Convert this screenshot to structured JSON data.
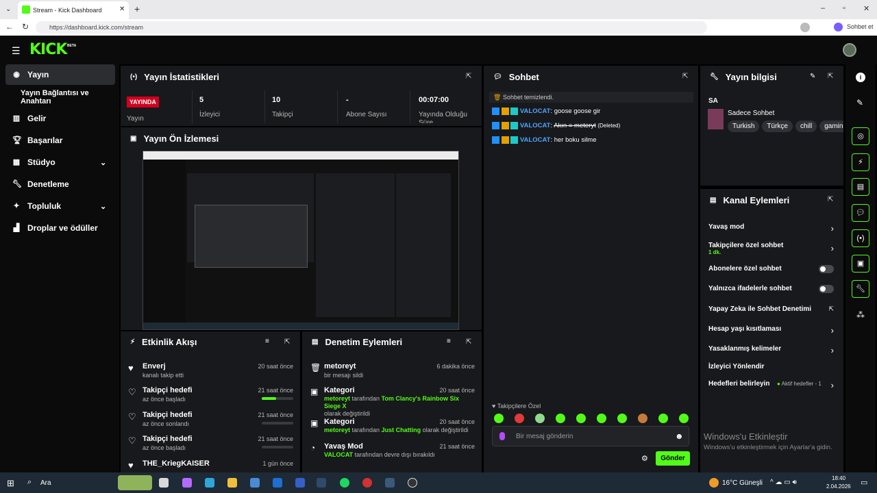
{
  "browser": {
    "tab_title": "Stream - Kick Dashboard",
    "url": "https://dashboard.kick.com/stream",
    "copilot_label": "Sohbet et"
  },
  "header": {
    "logo": "KICK",
    "logo_badge": "BETA"
  },
  "sidebar": {
    "items": [
      {
        "label": "Yayın",
        "icon": "broadcast-icon"
      },
      {
        "label": "Yayın Bağlantısı ve Anahtarı",
        "icon": ""
      },
      {
        "label": "Gelir",
        "icon": "chart-icon"
      },
      {
        "label": "Başarılar",
        "icon": "trophy-icon"
      },
      {
        "label": "Stüdyo",
        "icon": "studio-icon"
      },
      {
        "label": "Denetleme",
        "icon": "wrench-icon"
      },
      {
        "label": "Topluluk",
        "icon": "community-icon"
      },
      {
        "label": "Droplar ve ödüller",
        "icon": "drops-icon"
      }
    ]
  },
  "stats": {
    "title": "Yayın İstatistikleri",
    "live_badge": "YAYINDA",
    "live_label": "Yayın",
    "items": [
      {
        "value": "5",
        "label": "İzleyici"
      },
      {
        "value": "10",
        "label": "Takipçi"
      },
      {
        "value": "-",
        "label": "Abone Sayısı"
      },
      {
        "value": "00:07:00",
        "label": "Yayında Olduğu Süre"
      }
    ]
  },
  "preview": {
    "title": "Yayın Ön İzlemesi"
  },
  "activity": {
    "title": "Etkinlik Akışı",
    "items": [
      {
        "name": "Enverj",
        "desc": "kanalı takip etti",
        "time": "20 saat önce",
        "progress": null
      },
      {
        "name": "Takipçi hedefi",
        "desc": "az önce başladı",
        "time": "21 saat önce",
        "progress": 0.45
      },
      {
        "name": "Takipçi hedefi",
        "desc": "az önce sonlandı",
        "time": "21 saat önce",
        "progress": 0
      },
      {
        "name": "Takipçi hedefi",
        "desc": "az önce başladı",
        "time": "21 saat önce",
        "progress": 0
      },
      {
        "name": "THE_KriegKAISER",
        "desc": "",
        "time": "1 gün önce",
        "progress": null
      }
    ]
  },
  "moderation": {
    "title": "Denetim Eylemleri",
    "items": [
      {
        "name": "metoreyt",
        "actor": "",
        "pre": "",
        "mid": "bir mesajı sildi",
        "value": "",
        "post": "",
        "time": "6 dakika önce"
      },
      {
        "name": "Kategori",
        "actor": "metoreyt",
        "pre": "",
        "mid": " tarafından ",
        "value": "Tom Clancy's Rainbow Six Siege X",
        "post": "olarak değiştirildi",
        "time": "20 saat önce"
      },
      {
        "name": "Kategori",
        "actor": "metoreyt",
        "pre": "",
        "mid": " tarafından ",
        "value": "Just Chatting",
        "post": " olarak değiştirildi",
        "time": "20 saat önce"
      },
      {
        "name": "Yavaş Mod",
        "actor": "VALOCAT",
        "pre": "",
        "mid": " tarafından devre dışı bırakıldı",
        "value": "",
        "post": "",
        "time": "21 saat önce"
      }
    ]
  },
  "chat": {
    "title": "Sohbet",
    "cleared": "Sohbet temizlendi.",
    "messages": [
      {
        "user": "VALOCAT",
        "text": "goose goose gir",
        "deleted": false,
        "deleted_label": ""
      },
      {
        "user": "VALOCAT",
        "text": "Akın = meteryt",
        "deleted": true,
        "deleted_label": "(Deleted)"
      },
      {
        "user": "VALOCAT",
        "text": "her boku silme",
        "deleted": false,
        "deleted_label": ""
      }
    ],
    "mode_label": "Takipçilere Özel",
    "input_placeholder": "Bir mesaj gönderin",
    "send_label": "Gönder"
  },
  "stream_info": {
    "title": "Yayın bilgisi",
    "stream_title": "SA",
    "category": "Sadece Sohbet",
    "tags": [
      "Turkish",
      "Türkçe",
      "chill",
      "gamin"
    ]
  },
  "channel_actions": {
    "title": "Kanal Eylemleri",
    "items": [
      {
        "label": "Yavaş mod",
        "sub": "",
        "control": "chevron",
        "extra": ""
      },
      {
        "label": "Takipçilere özel sohbet",
        "sub": "1 dk.",
        "control": "chevron",
        "extra": ""
      },
      {
        "label": "Abonelere özel sohbet",
        "sub": "",
        "control": "toggle",
        "extra": ""
      },
      {
        "label": "Yalnızca ifadelerle sohbet",
        "sub": "",
        "control": "toggle",
        "extra": ""
      },
      {
        "label": "Yapay Zeka ile Sohbet Denetimi",
        "sub": "",
        "control": "external",
        "extra": ""
      },
      {
        "label": "Hesap yaşı kısıtlaması",
        "sub": "",
        "control": "chevron",
        "extra": ""
      },
      {
        "label": "Yasaklanmış kelimeler",
        "sub": "",
        "control": "chevron",
        "extra": ""
      },
      {
        "label": "İzleyici Yönlendir",
        "sub": "",
        "control": "",
        "extra": ""
      },
      {
        "label": "Hedefleri belirleyin",
        "sub": "",
        "control": "chevron",
        "extra": "Aktif hedefler - 1"
      }
    ]
  },
  "watermark": {
    "line1": "Windows'u Etkinleştir",
    "line2": "Windows'u etkinleştirmek için Ayarlar'a gidin."
  },
  "taskbar": {
    "search": "Ara",
    "weather": "16°C Güneşli",
    "time": "18:40",
    "date": "2.04.2026"
  },
  "colors": {
    "accent": "#53fc18",
    "live": "#d2001e",
    "panel": "#18191c",
    "bg": "#000000"
  }
}
